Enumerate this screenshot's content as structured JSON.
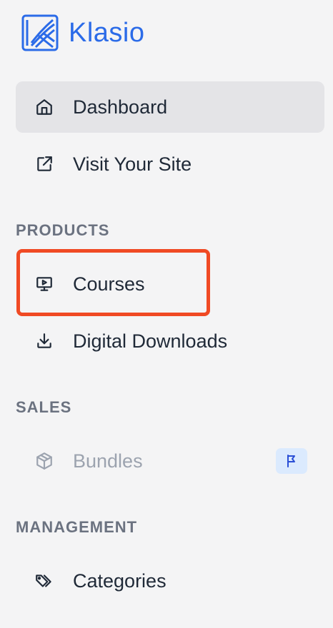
{
  "brand": {
    "name": "Klasio",
    "logo_icon": "klasio-logo",
    "accent": "#2b6be8"
  },
  "nav": {
    "dashboard": {
      "label": "Dashboard",
      "icon": "home-icon",
      "active": true
    },
    "visit_site": {
      "label": "Visit Your Site",
      "icon": "external-link-icon"
    }
  },
  "sections": {
    "products": {
      "title": "PRODUCTS",
      "items": [
        {
          "label": "Courses",
          "icon": "presentation-screen-icon",
          "highlighted": true
        },
        {
          "label": "Digital Downloads",
          "icon": "download-icon"
        }
      ]
    },
    "sales": {
      "title": "SALES",
      "items": [
        {
          "label": "Bundles",
          "icon": "cube-icon",
          "disabled": true,
          "badge_icon": "flag-icon"
        }
      ]
    },
    "management": {
      "title": "MANAGEMENT",
      "items": [
        {
          "label": "Categories",
          "icon": "tags-icon"
        }
      ]
    }
  },
  "colors": {
    "highlight_border": "#f04a24",
    "active_bg": "#e4e4e7",
    "badge_bg": "#dbeafe"
  }
}
